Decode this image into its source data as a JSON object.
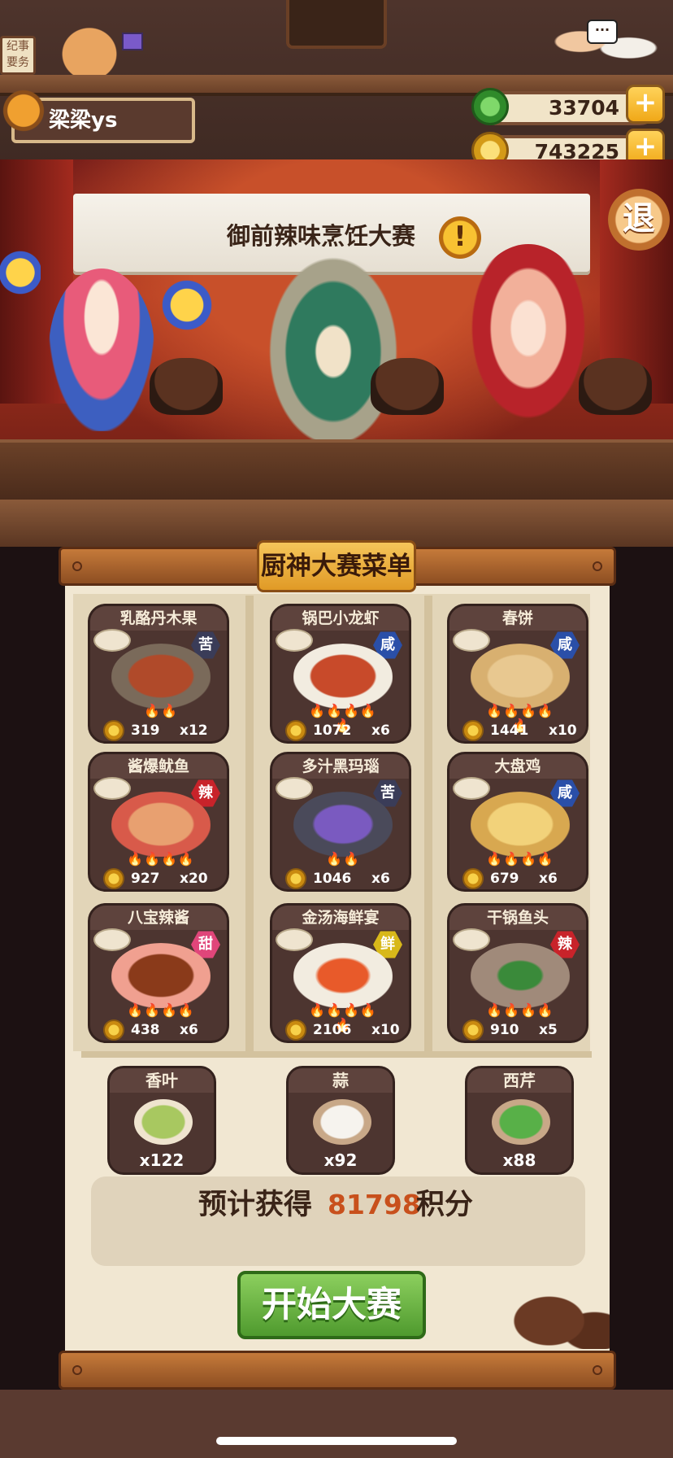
{
  "header": {
    "sign_text": "纪事\n要务",
    "chat_bubble": "···",
    "player_name": "梁梁ys",
    "currencies": [
      {
        "icon": "jade-gem-icon",
        "value": "33704",
        "color": "#4bb34a"
      },
      {
        "icon": "gold-coin-icon",
        "value": "743225",
        "color": "#f2c232"
      }
    ],
    "plus_label": "+"
  },
  "stage": {
    "banner_title": "御前辣味烹饪大赛",
    "alert_symbol": "!",
    "exit_label": "退"
  },
  "menu": {
    "title": "厨神大赛菜单",
    "dishes": [
      {
        "name": "乳酪丹木果",
        "flavor": "苦",
        "flavor_color": "#3a3c58",
        "price": "319",
        "qty": "x12",
        "herb": "香叶",
        "flames": "🔥🔥"
      },
      {
        "name": "锅巴小龙虾",
        "flavor": "咸",
        "flavor_color": "#2a4fa8",
        "price": "1072",
        "qty": "x6",
        "herb": "蒜",
        "flames": "🔥🔥🔥🔥🔥"
      },
      {
        "name": "春饼",
        "flavor": "咸",
        "flavor_color": "#2a4fa8",
        "price": "1441",
        "qty": "x10",
        "herb": "西芹",
        "flames": "🔥🔥🔥🔥🔥"
      },
      {
        "name": "酱爆鱿鱼",
        "flavor": "辣",
        "flavor_color": "#c8232a",
        "price": "927",
        "qty": "x20",
        "herb": "香叶",
        "flames": "🔥🔥🔥🔥"
      },
      {
        "name": "多汁黑玛瑙",
        "flavor": "苦",
        "flavor_color": "#3a3c58",
        "price": "1046",
        "qty": "x6",
        "herb": "蒜",
        "flames": "🔥🔥"
      },
      {
        "name": "大盘鸡",
        "flavor": "咸",
        "flavor_color": "#2a4fa8",
        "price": "679",
        "qty": "x6",
        "herb": "西芹",
        "flames": "🔥🔥🔥🔥"
      },
      {
        "name": "八宝辣酱",
        "flavor": "甜",
        "flavor_color": "#e0467a",
        "price": "438",
        "qty": "x6",
        "herb": "香叶",
        "flames": "🔥🔥🔥🔥"
      },
      {
        "name": "金汤海鲜宴",
        "flavor": "鲜",
        "flavor_color": "#d8b81a",
        "price": "2106",
        "qty": "x10",
        "herb": "蒜",
        "flames": "🔥🔥🔥🔥🔥"
      },
      {
        "name": "干锅鱼头",
        "flavor": "辣",
        "flavor_color": "#c8232a",
        "price": "910",
        "qty": "x5",
        "herb": "西芹",
        "flames": "🔥🔥🔥🔥"
      }
    ],
    "ingredients": [
      {
        "name": "香叶",
        "qty": "x122",
        "color": "#a8c860"
      },
      {
        "name": "蒜",
        "qty": "x92",
        "color": "#f2efe8"
      },
      {
        "name": "西芹",
        "qty": "x88",
        "color": "#58b048"
      }
    ],
    "score": {
      "prefix": "预计获得",
      "value": "81798",
      "suffix": "积分"
    },
    "start_label": "开始大赛"
  }
}
